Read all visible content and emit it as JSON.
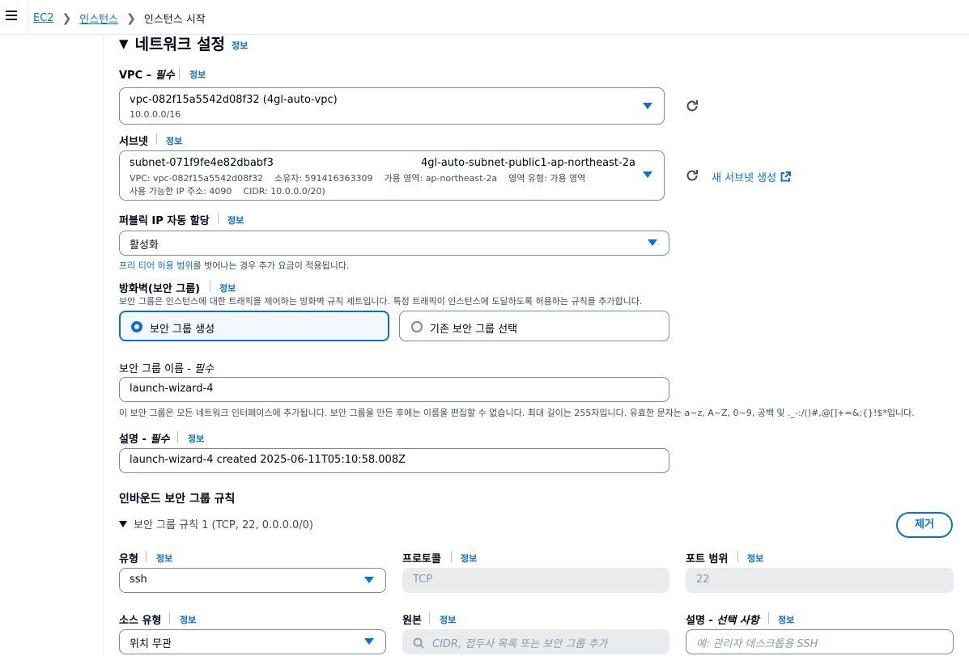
{
  "breadcrumb": {
    "items": [
      "EC2",
      "인스턴스"
    ],
    "current": "인스턴스 시작"
  },
  "section": {
    "title": "네트워크 설정",
    "info": "정보"
  },
  "vpc": {
    "label": "VPC – ",
    "required": "필수",
    "info": "정보",
    "value": "vpc-082f15a5542d08f32 (4gl-auto-vpc)",
    "cidr": "10.0.0.0/16"
  },
  "subnet": {
    "label": "서브넷",
    "info": "정보",
    "value": "subnet-071f9fe4e82dbabf3",
    "name": "4gl-auto-subnet-public1-ap-northeast-2a",
    "detail1": "VPC: vpc-082f15a5542d08f32    소유자: 591416363309    가용 영역: ap-northeast-2a    영역 유형: 가용 영역",
    "detail2": "사용 가능한 IP 주소: 4090    CIDR: 10.0.0.0/20)",
    "create_link": "새 서브넷 생성"
  },
  "public_ip": {
    "label": "퍼블릭 IP 자동 할당",
    "info": "정보",
    "value": "활성화",
    "hint_link": "프리 티어 허용 범위",
    "hint_rest": "를 벗어나는 경우 추가 요금이 적용됩니다."
  },
  "firewall": {
    "label": "방화벽(보안 그룹)",
    "info": "정보",
    "desc": "보안 그룹은 인스턴스에 대한 트래픽을 제어하는 방화벽 규칙 세트입니다. 특정 트래픽이 인스턴스에 도달하도록 허용하는 규칙을 추가합니다.",
    "option_create": "보안 그룹 생성",
    "option_existing": "기존 보안 그룹 선택",
    "selected": "보안 그룹 생성"
  },
  "sg_name": {
    "label": "보안 그룹 이름 - ",
    "required": "필수",
    "value": "launch-wizard-4",
    "hint": "이 보안 그룹은 모든 네트워크 인터페이스에 추가됩니다. 보안 그룹을 만든 후에는 이름을 편집할 수 없습니다. 최대 길이는 255자입니다. 유효한 문자는 a~z, A~Z, 0~9, 공백 및 ._-:/()#,@[]+=&;{}!$*입니다."
  },
  "description": {
    "label": "설명 - ",
    "required": "필수",
    "info": "정보",
    "value": "launch-wizard-4 created 2025-06-11T05:10:58.008Z"
  },
  "inbound": {
    "title": "인바운드 보안 그룹 규칙",
    "rule_title": "보안 그룹 규칙 1 (TCP, 22, 0.0.0.0/0)",
    "remove_button": "제거",
    "type": {
      "label": "유형",
      "info": "정보",
      "value": "ssh"
    },
    "protocol": {
      "label": "프로토콜",
      "info": "정보",
      "value": "TCP"
    },
    "port_range": {
      "label": "포트 범위",
      "info": "정보",
      "value": "22"
    },
    "source_type": {
      "label": "소스 유형",
      "info": "정보",
      "value": "위치 무관"
    },
    "source": {
      "label": "원본",
      "info": "정보",
      "placeholder": "CIDR, 접두사 목록 또는 보안 그룹 추가"
    },
    "rule_description": {
      "label": "설명 - ",
      "optional": "선택 사항",
      "info": "정보",
      "placeholder": "예: 관리자 데스크톱용 SSH"
    }
  },
  "colors": {
    "link": "#0972d3",
    "text": "#000716",
    "border": "#7d8998",
    "disabled": "#e9ebed"
  }
}
